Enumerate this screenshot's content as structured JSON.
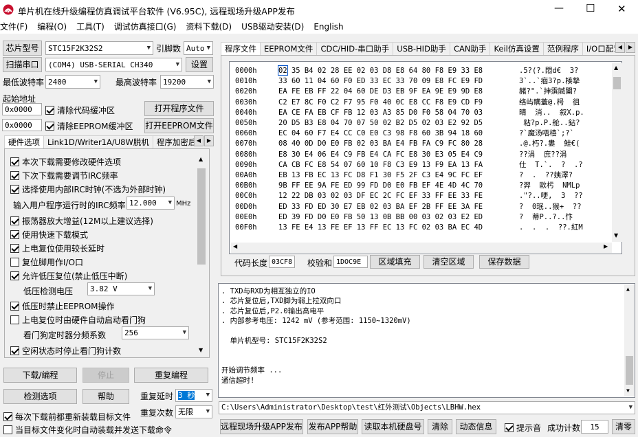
{
  "window": {
    "title": "单片机在线升级编程仿真调试平台软件 (V6.95C), 远程现场升级APP发布",
    "min_symbol": "—",
    "max_symbol": "☐",
    "close_symbol": "✕"
  },
  "menu": [
    "文件(F)",
    "编程(O)",
    "工具(T)",
    "调试仿真接口(G)",
    "资料下载(D)",
    "USB驱动安装(D)",
    "English"
  ],
  "left": {
    "chip_btn": "芯片型号",
    "chip_value": "STC15F2K32S2",
    "pins_label": "引脚数",
    "pins_value": "Auto",
    "scan_btn": "扫描串口",
    "port_value": "(COM4) USB-SERIAL CH340",
    "settings_btn": "设置",
    "min_baud_label": "最低波特率",
    "min_baud_value": "2400",
    "max_baud_label": "最高波特率",
    "max_baud_value": "19200",
    "start_addr_label": "起始地址",
    "addr1": "0x0000",
    "clear_code_label": "清除代码缓冲区",
    "open_prog_btn": "打开程序文件",
    "addr2": "0x0000",
    "clear_eeprom_label": "清除EEPROM缓冲区",
    "open_eeprom_btn": "打开EEPROM文件",
    "tabs": [
      "硬件选项",
      "Link1D/Writer1A/U8W脱机",
      "程序加密后"
    ],
    "options": [
      {
        "label": "本次下载需要修改硬件选项",
        "checked": true
      },
      {
        "label": "下次下载需要调节IRC频率",
        "checked": true
      },
      {
        "label": "选择使用内部IRC时钟(不选为外部时钟)",
        "checked": true
      },
      {
        "label": "振荡器放大增益(12M以上建议选择)",
        "checked": true
      },
      {
        "label": "使用快速下载模式",
        "checked": true
      },
      {
        "label": "上电复位使用较长延时",
        "checked": true
      },
      {
        "label": "复位脚用作I/O口",
        "checked": false
      },
      {
        "label": "允许低压复位(禁止低压中断)",
        "checked": true
      },
      {
        "label": "低压时禁止EEPROM操作",
        "checked": true
      },
      {
        "label": "上电复位时由硬件自动启动看门狗",
        "checked": false
      },
      {
        "label": "空闲状态时停止看门狗计数",
        "checked": true
      }
    ],
    "irc_label": "输入用户程序运行时的IRC频率",
    "irc_value": "12.000",
    "irc_unit": "MHz",
    "lvd_label": "低压检测电压",
    "lvd_value": "3.82 V",
    "wdt_label": "看门狗定时器分频系数",
    "wdt_value": "256",
    "download_btn": "下载/编程",
    "stop_btn": "停止",
    "reprog_btn": "重复编程",
    "check_btn": "检测选项",
    "help_btn": "帮助",
    "delay_label": "重复延时",
    "delay_value": "3 秒",
    "count_label": "重复次数",
    "count_value": "无限",
    "reload_label": "每次下载前都重新装载目标文件",
    "auto_send_label": "当目标文件变化时自动装载并发送下载命令"
  },
  "right": {
    "tabs": [
      "程序文件",
      "EEPROM文件",
      "CDC/HID-串口助手",
      "USB-HID助手",
      "CAN助手",
      "Keil仿真设置",
      "范例程序",
      "I/O口配置"
    ],
    "hex_rows": [
      {
        "addr": "0000h",
        "bytes": "02 35 B4 02 28 EE 02 03 D8 E8 64 80 F8 E9 33 E8",
        "ascii": ".5?(?.悶d€  3?"
      },
      {
        "addr": "0010h",
        "bytes": "33 60 11 04 60 F0 ED 33 EC 33 70 09 E8 FC E9 FD",
        "ascii": "3`..`痼3?p.楱摯"
      },
      {
        "addr": "0020h",
        "bytes": "EA FE EB FF 22 04 60 DE D3 EB 9F EA 9E E9 9D E8",
        "ascii": "赭?\".`抻霟隇闈?"
      },
      {
        "addr": "0030h",
        "bytes": "C2 E7 8C F0 C2 F7 95 F0 40 0C E8 CC F8 E9 CD F9",
        "ascii": "络屿瞒蓋@.枵  徂"
      },
      {
        "addr": "0040h",
        "bytes": "EA CE FA EB CF FB 12 03 A3 85 D0 F0 58 04 70 03",
        "ascii": "晴  消..  叙X.p."
      },
      {
        "addr": "0050h",
        "bytes": "20 D5 B3 E8 04 70 07 50 02 B2 D5 02 03 E2 92 D5",
        "ascii": " 粘?p.P.舱..鉆?"
      },
      {
        "addr": "0060h",
        "bytes": "EC 04 60 F7 E4 CC C0 E0 C3 98 F8 60 3B 94 18 60",
        "ascii": "?`魔汤唔橲`;?`"
      },
      {
        "addr": "0070h",
        "bytes": "08 40 0D D0 E0 FB 02 03 BA E4 FB FA C9 FC 80 28",
        "ascii": ".@.朽?.婁  鮭€("
      },
      {
        "addr": "0080h",
        "bytes": "E8 30 E4 06 E4 C9 FB E4 CA FC E8 30 E3 05 E4 C9",
        "ascii": "??涓  庶??涓"
      },
      {
        "addr": "0090h",
        "bytes": "CA CB FC E8 54 07 60 10 F8 C3 E9 13 F9 EA 13 FA",
        "ascii": "仕  T.`.  ?  .?"
      },
      {
        "addr": "00A0h",
        "bytes": "EB 13 FB EC 13 FC D8 F1 30 F5 2F C3 E4 9C FC EF",
        "ascii": "?  .  ??姨澤?"
      },
      {
        "addr": "00B0h",
        "bytes": "9B FF EE 9A FE ED 99 FD D0 E0 FB EF 4E 4D 4C 70",
        "ascii": "?羿  歐杇  NMLp"
      },
      {
        "addr": "00C0h",
        "bytes": "12 22 DB 03 02 03 DF EC 2C FC EF 33 FF EE 33 FE",
        "ascii": ".\"?..哽,  3  ??"
      },
      {
        "addr": "00D0h",
        "bytes": "ED 33 FD ED 30 E7 EB 02 03 BA EF 2B FF EE 3A FE",
        "ascii": "?  0珉..猴+  ??"
      },
      {
        "addr": "00E0h",
        "bytes": "ED 39 FD D0 E0 FB 50 13 0B BB 00 03 02 03 E2 ED",
        "ascii": "?  蒂P..?..忭"
      },
      {
        "addr": "00F0h",
        "bytes": "13 FE E4 13 FE EF 13 FF EC 13 FC 02 03 BA EC 4D",
        "ascii": ".  .  .  ??.紅M"
      }
    ],
    "code_len_label": "代码长度",
    "code_len_value": "03CF8",
    "checksum_label": "校验和",
    "checksum_value": "1DOC9E",
    "fill_btn": "区域填充",
    "clear_btn": "清空区域",
    "save_btn": "保存数据",
    "log": [
      ". TXD与RXD为相互独立的IO",
      ". 芯片复位后,TXD脚为弱上拉双向口",
      ". 芯片复位后,P2.0输出高电平",
      ". 内部参考电压: 1242 mV (参考范围: 1150~1320mV)",
      "",
      "  单片机型号: STC15F2K32S2",
      "",
      "",
      "开始调节频率 ...",
      "通信超时!"
    ],
    "path_value": "C:\\Users\\Administrator\\Desktop\\test\\红外测试\\Objects\\LBHW.hex",
    "remote_btn": "远程现场升级APP发布",
    "publish_help_btn": "发布APP帮助",
    "read_disk_btn": "读取本机硬盘号",
    "clear_log_btn": "清除",
    "dynamic_btn": "动态信息",
    "beep_label": "提示音",
    "success_label": "成功计数",
    "success_value": "15",
    "reset_count_btn": "清零"
  }
}
